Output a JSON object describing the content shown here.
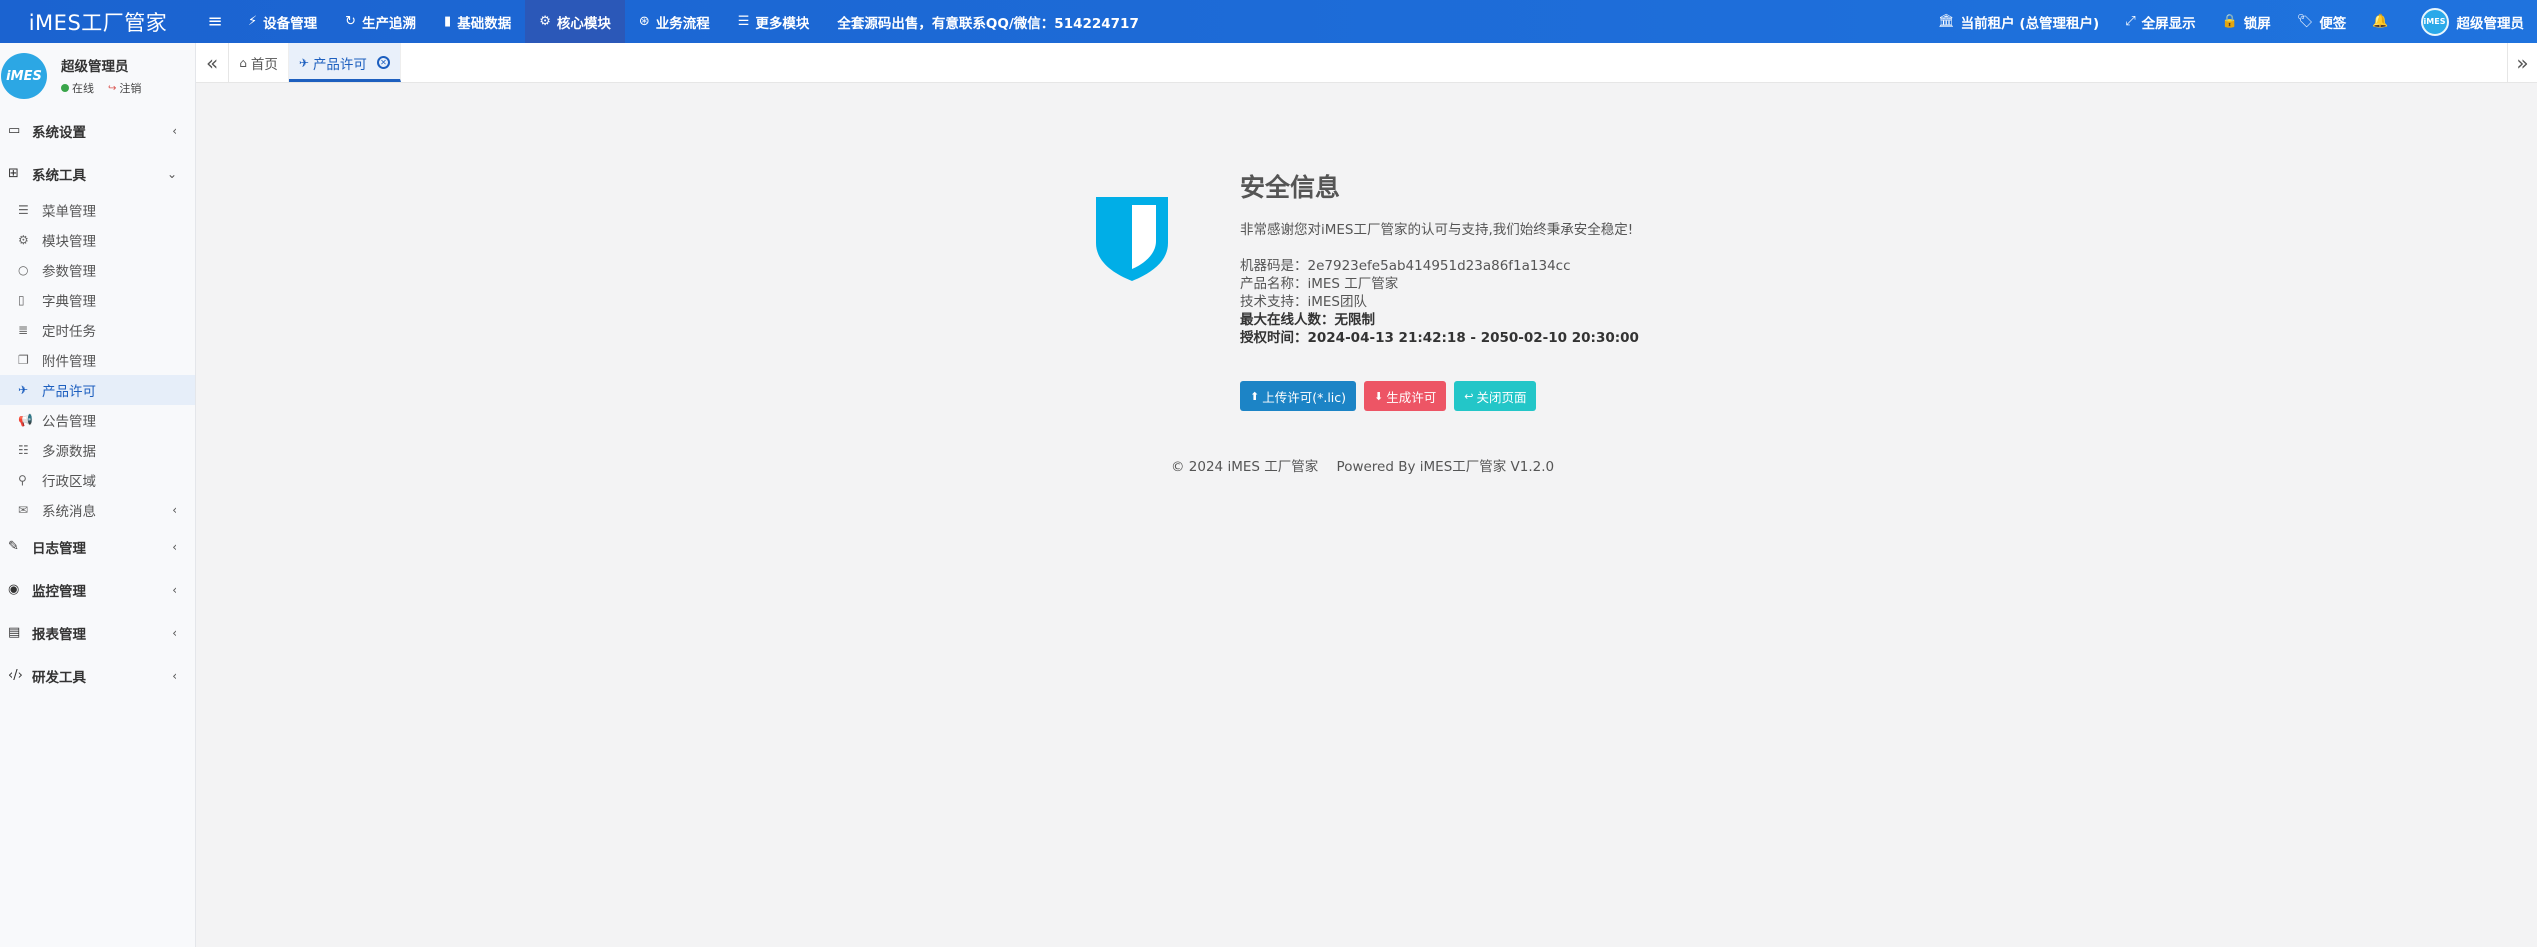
{
  "brand": "iMES工厂管家",
  "colors": {
    "topbar": "#1e6fd9",
    "accent": "#1d5fbf",
    "shield": "#00aee7",
    "btn_primary": "#1c84c6",
    "btn_danger": "#ed5565",
    "btn_info": "#23c6c8"
  },
  "topnav": {
    "menu_icon": "hamburger-icon",
    "items": [
      {
        "label": "设备管理",
        "icon": "bolt-icon"
      },
      {
        "label": "生产追溯",
        "icon": "refresh-icon"
      },
      {
        "label": "基础数据",
        "icon": "book-icon"
      },
      {
        "label": "核心模块",
        "icon": "gear-icon"
      },
      {
        "label": "业务流程",
        "icon": "life-ring-icon"
      },
      {
        "label": "更多模块",
        "icon": "list-icon"
      }
    ],
    "notice": "全套源码出售，有意联系QQ/微信：514224717",
    "right": {
      "tenant": "当前租户 (总管理租户)",
      "fullscreen": "全屏显示",
      "lock": "锁屏",
      "notes": "便签",
      "username": "超级管理员",
      "avatar_text": "iMES"
    }
  },
  "sidebar": {
    "user": {
      "avatar_text": "iMES",
      "name": "超级管理员",
      "status": "在线",
      "logout": "注销"
    },
    "groups": [
      {
        "label": "系统设置",
        "icon": "desktop-icon",
        "expanded": false
      },
      {
        "label": "系统工具",
        "icon": "windows-icon",
        "expanded": true,
        "items": [
          {
            "label": "菜单管理",
            "icon": "list-icon"
          },
          {
            "label": "模块管理",
            "icon": "gears-icon"
          },
          {
            "label": "参数管理",
            "icon": "settings-icon"
          },
          {
            "label": "字典管理",
            "icon": "bookmark-icon"
          },
          {
            "label": "定时任务",
            "icon": "tasks-icon"
          },
          {
            "label": "附件管理",
            "icon": "clone-icon"
          },
          {
            "label": "产品许可",
            "icon": "paper-plane-icon",
            "active": true
          },
          {
            "label": "公告管理",
            "icon": "bullhorn-icon"
          },
          {
            "label": "多源数据",
            "icon": "database-icon"
          },
          {
            "label": "行政区域",
            "icon": "map-marker-icon"
          },
          {
            "label": "系统消息",
            "icon": "envelope-open-icon"
          }
        ]
      },
      {
        "label": "日志管理",
        "icon": "edit-icon",
        "expanded": false
      },
      {
        "label": "监控管理",
        "icon": "eye-icon",
        "expanded": false
      },
      {
        "label": "报表管理",
        "icon": "file-chart-icon",
        "expanded": false
      },
      {
        "label": "研发工具",
        "icon": "code-icon",
        "expanded": false
      }
    ]
  },
  "tabs": {
    "items": [
      {
        "label": "首页",
        "icon": "home-icon"
      },
      {
        "label": "产品许可",
        "icon": "paper-plane-icon",
        "active": true
      }
    ]
  },
  "content": {
    "title": "安全信息",
    "desc": "非常感谢您对iMES工厂管家的认可与支持,我们始终秉承安全稳定!",
    "machine_code": "机器码是：2e7923efe5ab414951d23a86f1a134cc",
    "product_name": "产品名称：iMES 工厂管家",
    "support": "技术支持：iMES团队",
    "max_online": "最大在线人数：无限制",
    "license_time": "授权时间：2024-04-13 21:42:18 - 2050-02-10 20:30:00",
    "buttons": {
      "upload": "上传许可(*.lic)",
      "generate": "生成许可",
      "close": "关闭页面"
    }
  },
  "footer": {
    "copyright": "© 2024 iMES 工厂管家",
    "powered": "Powered By iMES工厂管家 V1.2.0"
  }
}
